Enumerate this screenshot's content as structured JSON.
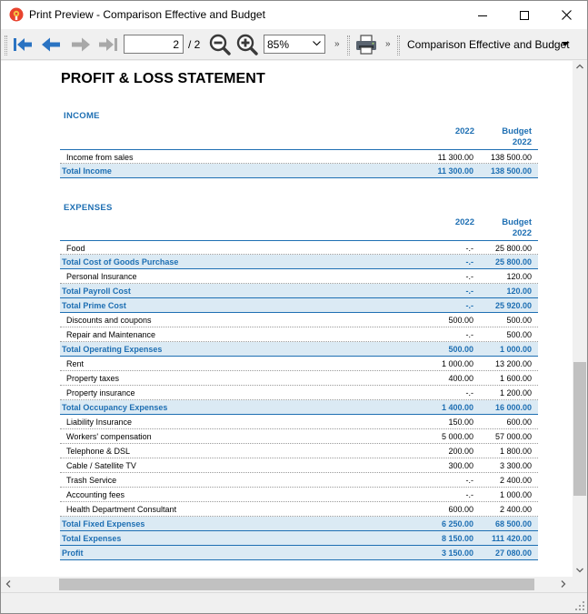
{
  "window": {
    "title": "Print Preview - Comparison Effective and Budget"
  },
  "toolbar": {
    "page_value": "2",
    "page_total": "/ 2",
    "zoom_value": "85%",
    "overflow_1": "»",
    "overflow_2": "»",
    "overflow_3": "»",
    "report_name": "Comparison Effective and Budget"
  },
  "report": {
    "title": "PROFIT & LOSS STATEMENT",
    "income": {
      "heading": "INCOME",
      "col1": "2022",
      "col2_line1": "Budget",
      "col2_line2": "2022",
      "rows": [
        {
          "label": "Income from sales",
          "v1": "11 300.00",
          "v2": "138 500.00",
          "total": false
        },
        {
          "label": "Total Income",
          "v1": "11 300.00",
          "v2": "138 500.00",
          "total": true
        }
      ]
    },
    "expenses": {
      "heading": "EXPENSES",
      "col1": "2022",
      "col2_line1": "Budget",
      "col2_line2": "2022",
      "rows": [
        {
          "label": "Food",
          "v1": "-.-",
          "v2": "25 800.00",
          "total": false
        },
        {
          "label": "Total Cost of Goods Purchase",
          "v1": "-.-",
          "v2": "25 800.00",
          "total": true
        },
        {
          "label": "Personal Insurance",
          "v1": "-.-",
          "v2": "120.00",
          "total": false
        },
        {
          "label": "Total Payroll Cost",
          "v1": "-.-",
          "v2": "120.00",
          "total": true
        },
        {
          "label": "Total Prime Cost",
          "v1": "-.-",
          "v2": "25 920.00",
          "total": true
        },
        {
          "label": "Discounts and coupons",
          "v1": "500.00",
          "v2": "500.00",
          "total": false
        },
        {
          "label": "Repair and Maintenance",
          "v1": "-.-",
          "v2": "500.00",
          "total": false
        },
        {
          "label": "Total Operating Expenses",
          "v1": "500.00",
          "v2": "1 000.00",
          "total": true
        },
        {
          "label": "Rent",
          "v1": "1 000.00",
          "v2": "13 200.00",
          "total": false
        },
        {
          "label": "Property taxes",
          "v1": "400.00",
          "v2": "1 600.00",
          "total": false
        },
        {
          "label": "Property insurance",
          "v1": "-.-",
          "v2": "1 200.00",
          "total": false
        },
        {
          "label": "Total Occupancy Expenses",
          "v1": "1 400.00",
          "v2": "16 000.00",
          "total": true
        },
        {
          "label": "Liability Insurance",
          "v1": "150.00",
          "v2": "600.00",
          "total": false
        },
        {
          "label": "Workers' compensation",
          "v1": "5 000.00",
          "v2": "57 000.00",
          "total": false
        },
        {
          "label": "Telephone & DSL",
          "v1": "200.00",
          "v2": "1 800.00",
          "total": false
        },
        {
          "label": "Cable / Satellite TV",
          "v1": "300.00",
          "v2": "3 300.00",
          "total": false
        },
        {
          "label": "Trash Service",
          "v1": "-.-",
          "v2": "2 400.00",
          "total": false
        },
        {
          "label": "Accounting fees",
          "v1": "-.-",
          "v2": "1 000.00",
          "total": false
        },
        {
          "label": "Health Department Consultant",
          "v1": "600.00",
          "v2": "2 400.00",
          "total": false
        },
        {
          "label": "Total Fixed Expenses",
          "v1": "6 250.00",
          "v2": "68 500.00",
          "total": true
        },
        {
          "label": "Total Expenses",
          "v1": "8 150.00",
          "v2": "111 420.00",
          "total": true
        },
        {
          "label": "Profit",
          "v1": "3 150.00",
          "v2": "27 080.00",
          "total": true
        }
      ]
    }
  },
  "colors": {
    "accent": "#1e6fb3",
    "total_row_bg": "#dbeaf4",
    "nav_arrow_active": "#2a73c2",
    "nav_arrow_disabled": "#a8a8a8"
  },
  "icons": {
    "app": "banana-app-icon",
    "first": "first-page-arrow-icon",
    "prev": "previous-page-arrow-icon",
    "next": "next-page-arrow-icon",
    "last": "last-page-arrow-icon",
    "zoom_out": "zoom-out-icon",
    "zoom_in": "zoom-in-icon",
    "print": "printer-icon"
  }
}
